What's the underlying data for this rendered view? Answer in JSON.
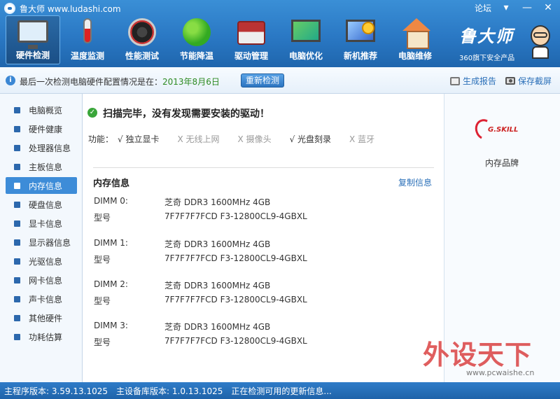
{
  "window": {
    "title": "鲁大师 www.ludashi.com",
    "forum_label": "论坛"
  },
  "nav": [
    {
      "label": "硬件检测",
      "icon": "monitor-magnifier-icon"
    },
    {
      "label": "温度监测",
      "icon": "thermometer-icon"
    },
    {
      "label": "性能测试",
      "icon": "speed-gauge-icon"
    },
    {
      "label": "节能降温",
      "icon": "clover-icon"
    },
    {
      "label": "驱动管理",
      "icon": "toolbox-icon"
    },
    {
      "label": "电脑优化",
      "icon": "screen-optimize-icon"
    },
    {
      "label": "新机推荐",
      "icon": "new-pc-medal-icon"
    },
    {
      "label": "电脑维修",
      "icon": "house-repair-icon"
    }
  ],
  "brand": {
    "name": "鲁大师",
    "slogan": "360旗下安全产品"
  },
  "infobar": {
    "text": "最后一次检测电脑硬件配置情况是在：",
    "date": "2013年8月6日",
    "recheck_label": "重新检测",
    "report_label": "生成报告",
    "screenshot_label": "保存截屏"
  },
  "sidebar": [
    "电脑概览",
    "硬件健康",
    "处理器信息",
    "主板信息",
    "内存信息",
    "硬盘信息",
    "显卡信息",
    "显示器信息",
    "光驱信息",
    "网卡信息",
    "声卡信息",
    "其他硬件",
    "功耗估算"
  ],
  "main": {
    "scan_message": "扫描完毕，没有发现需要安装的驱动！",
    "features_label": "功能：",
    "features": [
      {
        "text": "√ 独立显卡",
        "enabled": true
      },
      {
        "text": "X 无线上网",
        "enabled": false
      },
      {
        "text": "X 摄像头",
        "enabled": false
      },
      {
        "text": "√ 光盘刻录",
        "enabled": true
      },
      {
        "text": "X 蓝牙",
        "enabled": false
      }
    ],
    "section_title": "内存信息",
    "copy_label": "复制信息",
    "dimms": [
      {
        "slot": "DIMM 0:",
        "desc": "芝奇 DDR3 1600MHz 4GB",
        "model_label": "型号",
        "model": "7F7F7F7FCD F3-12800CL9-4GBXL"
      },
      {
        "slot": "DIMM 1:",
        "desc": "芝奇 DDR3 1600MHz 4GB",
        "model_label": "型号",
        "model": "7F7F7F7FCD F3-12800CL9-4GBXL"
      },
      {
        "slot": "DIMM 2:",
        "desc": "芝奇 DDR3 1600MHz 4GB",
        "model_label": "型号",
        "model": "7F7F7F7FCD F3-12800CL9-4GBXL"
      },
      {
        "slot": "DIMM 3:",
        "desc": "芝奇 DDR3 1600MHz 4GB",
        "model_label": "型号",
        "model": "7F7F7F7FCD F3-12800CL9-4GBXL"
      }
    ]
  },
  "right_panel": {
    "logo_text": "G.SKILL",
    "caption": "内存品牌"
  },
  "watermark": {
    "main": "外设天下",
    "sub": "www.pcwaishe.cn"
  },
  "statusbar": {
    "program_version": "主程序版本: 3.59.13.1025",
    "db_version": "主设备库版本: 1.0.13.1025",
    "update_status": "正在检测可用的更新信息..."
  },
  "colors": {
    "header_blue": "#2a78c4",
    "active_item": "#3d8cd8",
    "date_green": "#2e8b22",
    "link_blue": "#2a6fb8"
  }
}
